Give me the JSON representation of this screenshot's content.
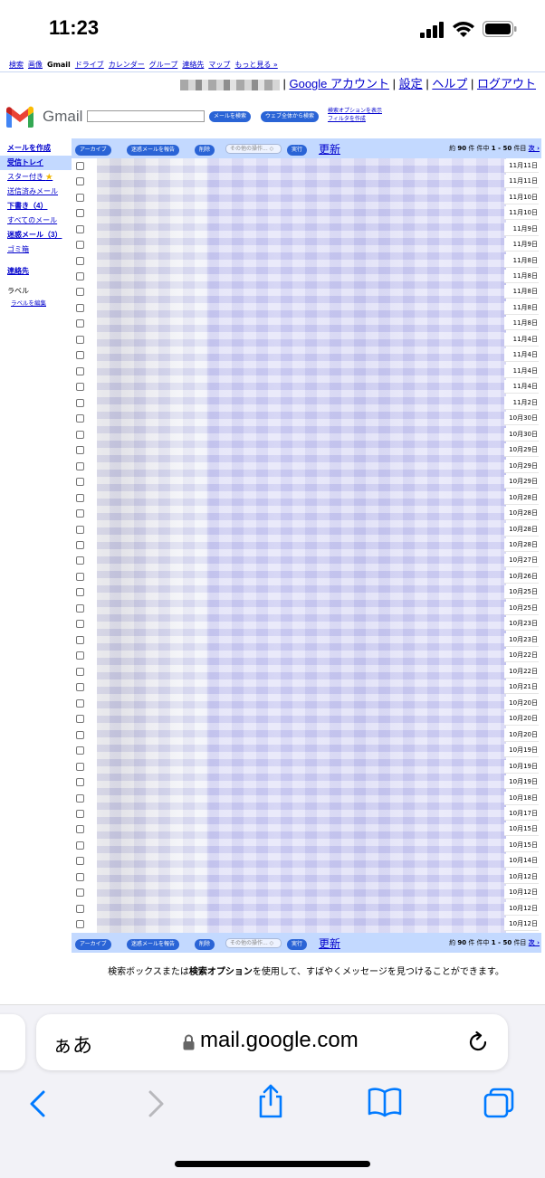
{
  "status_bar": {
    "time": "11:23"
  },
  "gmail": {
    "top_nav": [
      {
        "label": "検索",
        "current": false
      },
      {
        "label": "画像",
        "current": false
      },
      {
        "label": "Gmail",
        "current": true
      },
      {
        "label": "ドライブ",
        "current": false
      },
      {
        "label": "カレンダー",
        "current": false
      },
      {
        "label": "グループ",
        "current": false
      },
      {
        "label": "連絡先",
        "current": false
      },
      {
        "label": "マップ",
        "current": false
      },
      {
        "label": "もっと見る »",
        "current": false
      }
    ],
    "account_links": {
      "google_account": "Google アカウント",
      "settings": "設定",
      "help": "ヘルプ",
      "logout": "ログアウト",
      "separator": "|"
    },
    "logo_text": "Gmail",
    "search": {
      "search_mail": "メールを検索",
      "search_web": "ウェブ全体から検索",
      "show_options": "検索オプションを表示",
      "create_filter": "フィルタを作成"
    },
    "sidebar": {
      "compose": "メールを作成",
      "inbox": "受信トレイ",
      "starred": "スター付き",
      "sent": "送信済みメール",
      "drafts": "下書き（4）",
      "all_mail": "すべてのメール",
      "spam": "迷惑メール（3）",
      "trash": "ゴミ箱",
      "contacts": "連絡先",
      "labels_heading": "ラベル",
      "edit_labels": "ラベルを編集"
    },
    "toolbar": {
      "archive": "アーカイブ",
      "report_spam": "迷惑メールを報告",
      "delete": "削除",
      "more_actions": "その他の操作... ◇",
      "execute": "実行",
      "refresh": "更新",
      "count_prefix": "約",
      "count_total": "90",
      "count_mid": "件 件中",
      "count_range": "1 - 50",
      "count_suffix": "件目",
      "next": "次 ›"
    },
    "messages": [
      {
        "date": "11月11日"
      },
      {
        "date": "11月11日"
      },
      {
        "date": "11月10日"
      },
      {
        "date": "11月10日"
      },
      {
        "date": "11月9日"
      },
      {
        "date": "11月9日"
      },
      {
        "date": "11月8日"
      },
      {
        "date": "11月8日"
      },
      {
        "date": "11月8日"
      },
      {
        "date": "11月8日"
      },
      {
        "date": "11月8日"
      },
      {
        "date": "11月4日"
      },
      {
        "date": "11月4日"
      },
      {
        "date": "11月4日"
      },
      {
        "date": "11月4日"
      },
      {
        "date": "11月2日"
      },
      {
        "date": "10月30日"
      },
      {
        "date": "10月30日"
      },
      {
        "date": "10月29日"
      },
      {
        "date": "10月29日"
      },
      {
        "date": "10月29日"
      },
      {
        "date": "10月28日"
      },
      {
        "date": "10月28日"
      },
      {
        "date": "10月28日"
      },
      {
        "date": "10月28日"
      },
      {
        "date": "10月27日"
      },
      {
        "date": "10月26日"
      },
      {
        "date": "10月25日"
      },
      {
        "date": "10月25日"
      },
      {
        "date": "10月23日"
      },
      {
        "date": "10月23日"
      },
      {
        "date": "10月22日"
      },
      {
        "date": "10月22日"
      },
      {
        "date": "10月21日"
      },
      {
        "date": "10月20日"
      },
      {
        "date": "10月20日"
      },
      {
        "date": "10月20日"
      },
      {
        "date": "10月19日"
      },
      {
        "date": "10月19日"
      },
      {
        "date": "10月19日"
      },
      {
        "date": "10月18日"
      },
      {
        "date": "10月17日"
      },
      {
        "date": "10月15日"
      },
      {
        "date": "10月15日"
      },
      {
        "date": "10月14日"
      },
      {
        "date": "10月12日"
      },
      {
        "date": "10月12日"
      },
      {
        "date": "10月12日"
      },
      {
        "date": "10月12日"
      }
    ],
    "footer_tip_a": "検索ボックスまたは",
    "footer_tip_bold": "検索オプション",
    "footer_tip_b": "を使用して、すばやくメッセージを見つけることができます。"
  },
  "safari": {
    "text_size": "ぁあ",
    "url": "mail.google.com"
  },
  "colors": {
    "link": "#0000cc",
    "toolbar_bg": "#c3d9ff",
    "pill": "#2a64d6",
    "ios_blue": "#007aff"
  },
  "icons": [
    "signal-icon",
    "wifi-icon",
    "battery-icon",
    "gmail-logo-icon",
    "star-icon",
    "lock-icon",
    "reload-icon",
    "back-icon",
    "forward-icon",
    "share-icon",
    "bookmarks-icon",
    "tabs-icon"
  ]
}
